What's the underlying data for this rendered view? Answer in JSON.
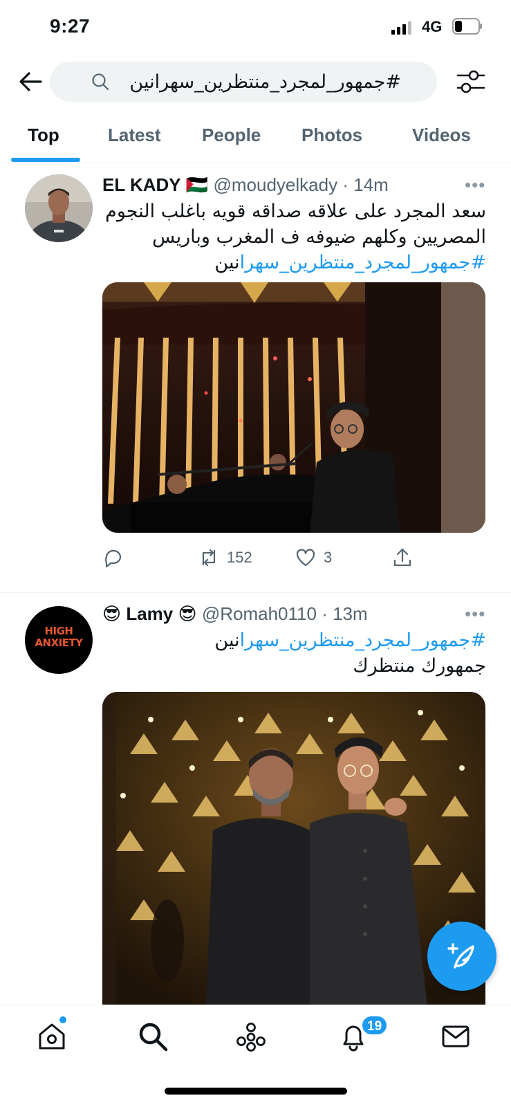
{
  "status_bar": {
    "time": "9:27",
    "network": "4G"
  },
  "search": {
    "query": "#جمهور_لمجرد_منتظرين_سهرانين"
  },
  "tabs": [
    {
      "label": "Top",
      "active": true
    },
    {
      "label": "Latest",
      "active": false
    },
    {
      "label": "People",
      "active": false
    },
    {
      "label": "Photos",
      "active": false
    },
    {
      "label": "Videos",
      "active": false
    }
  ],
  "tweets": [
    {
      "display_name": "EL KADY",
      "name_emoji_suffix": "🇵🇸",
      "handle": "@moudyelkady",
      "time": "· 14m",
      "body_lines": [
        "سعد المجرد على علاقه صداقه قويه باغلب النجوم",
        "المصريين وكلهم ضيوفه ف المغرب وباريس"
      ],
      "hashtag_linked": "#جمهور_لمجرد_منتظرين_سهرا",
      "hashtag_tail": "نين",
      "retweets": "152",
      "likes": "3"
    },
    {
      "display_name": "Lamy",
      "name_emoji": "😎",
      "handle": "@Romah0110",
      "time": "· 13m",
      "hashtag_linked": "#جمهور_لمجرد_منتظرين_سهرا",
      "hashtag_tail": "نين",
      "body_lines": [
        "جمهورك منتظرك"
      ],
      "avatar_text": [
        "HIGH",
        "ANXIETY"
      ]
    }
  ],
  "more_label": "•••",
  "notifications_badge": "19",
  "colors": {
    "accent": "#1d9bf0",
    "text": "#0f1419",
    "muted": "#536471"
  }
}
